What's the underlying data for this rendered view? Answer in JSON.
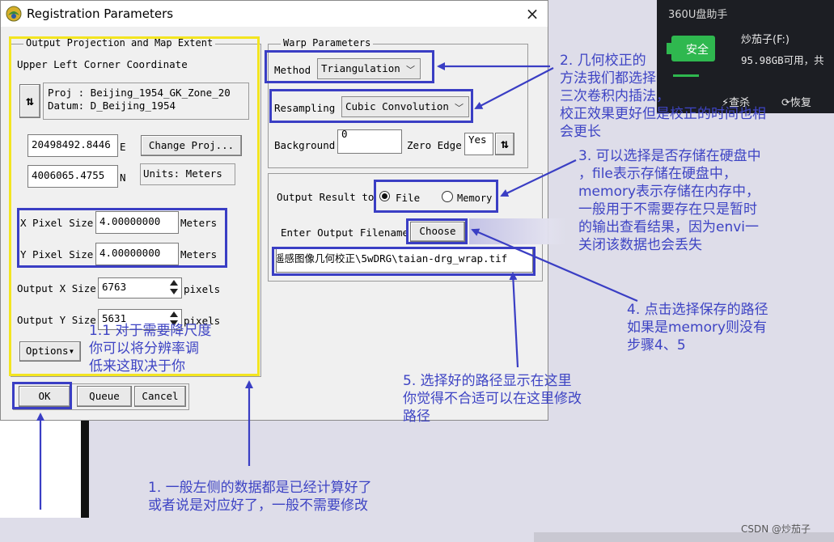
{
  "dialog": {
    "title": "Registration Parameters",
    "close_label": "×"
  },
  "output_projection": {
    "legend": "Output Projection and Map Extent",
    "ulc_label": "Upper Left Corner Coordinate",
    "swap_icon_label": "⇅",
    "proj_line": "Proj : Beijing_1954_GK_Zone_20",
    "datum_line": "Datum: D_Beijing_1954",
    "easting_value": "20498492.8446",
    "easting_unit": "E",
    "northing_value": "4006065.4755",
    "northing_unit": "N",
    "change_proj_label": "Change Proj...",
    "units_label": "Units: Meters",
    "x_pixel_label": "X Pixel Size",
    "x_pixel_value": "4.00000000",
    "x_pixel_unit": "Meters",
    "y_pixel_label": "Y Pixel Size",
    "y_pixel_value": "4.00000000",
    "y_pixel_unit": "Meters",
    "out_x_label": "Output X Size",
    "out_x_value": "6763",
    "out_x_unit": "pixels",
    "out_y_label": "Output Y Size",
    "out_y_value": "5631",
    "out_y_unit": "pixels",
    "options_label": "Options▾"
  },
  "warp": {
    "legend": "Warp Parameters",
    "method_label": "Method",
    "method_value": "Triangulation",
    "resampling_label": "Resampling",
    "resampling_value": "Cubic Convolution",
    "background_label": "Background",
    "background_value": "0",
    "zero_edge_label": "Zero Edge",
    "zero_edge_value": "Yes",
    "zero_edge_toggle": "⇅"
  },
  "output": {
    "result_label": "Output Result to",
    "file_label": "File",
    "memory_label": "Memory",
    "filename_label": "Enter Output Filename",
    "choose_label": "Choose",
    "filename_value": "遥感图像几何校正\\5wDRG\\taian-drg_wrap.tif"
  },
  "buttons": {
    "ok": "OK",
    "queue": "Queue",
    "cancel": "Cancel"
  },
  "popup360": {
    "title": "360U盘助手",
    "safe_badge": "安全",
    "drive_name": "炒茄子(F:)",
    "drive_free": "95.98GB可用，共",
    "view_label": "⚡查杀",
    "restore_label": "⟳恢复"
  },
  "annotations": {
    "a2": [
      "2. 几何校正的",
      "方法我们都选择",
      "三次卷积内插法，",
      "校正效果更好但是校正的时间也相",
      "会更长"
    ],
    "a3": [
      "3. 可以选择是否存储在硬盘中",
      "，file表示存储在硬盘中，",
      "memory表示存储在内存中，",
      "一般用于不需要存在只是暂时",
      "的输出查看结果，因为envi一",
      "关闭该数据也会丢失"
    ],
    "a4": [
      "4. 点击选择保存的路径",
      "如果是memory则没有",
      "步骤4、5"
    ],
    "a5": [
      "5. 选择好的路径显示在这里",
      "你觉得不合适可以在这里修改",
      "路径"
    ],
    "a11": [
      "1.1 对于需要降尺度",
      "你可以将分辨率调",
      "低来这取决于你"
    ],
    "a1": [
      "1. 一般左侧的数据都是已经计算好了",
      "或者说是对应好了，一般不需要修改"
    ]
  },
  "watermark": "CSDN @炒茄子",
  "colors": {
    "annotation_blue": "#3a3ec4",
    "highlight_yellow": "#f3e520",
    "safe_green": "#2fb84f"
  }
}
